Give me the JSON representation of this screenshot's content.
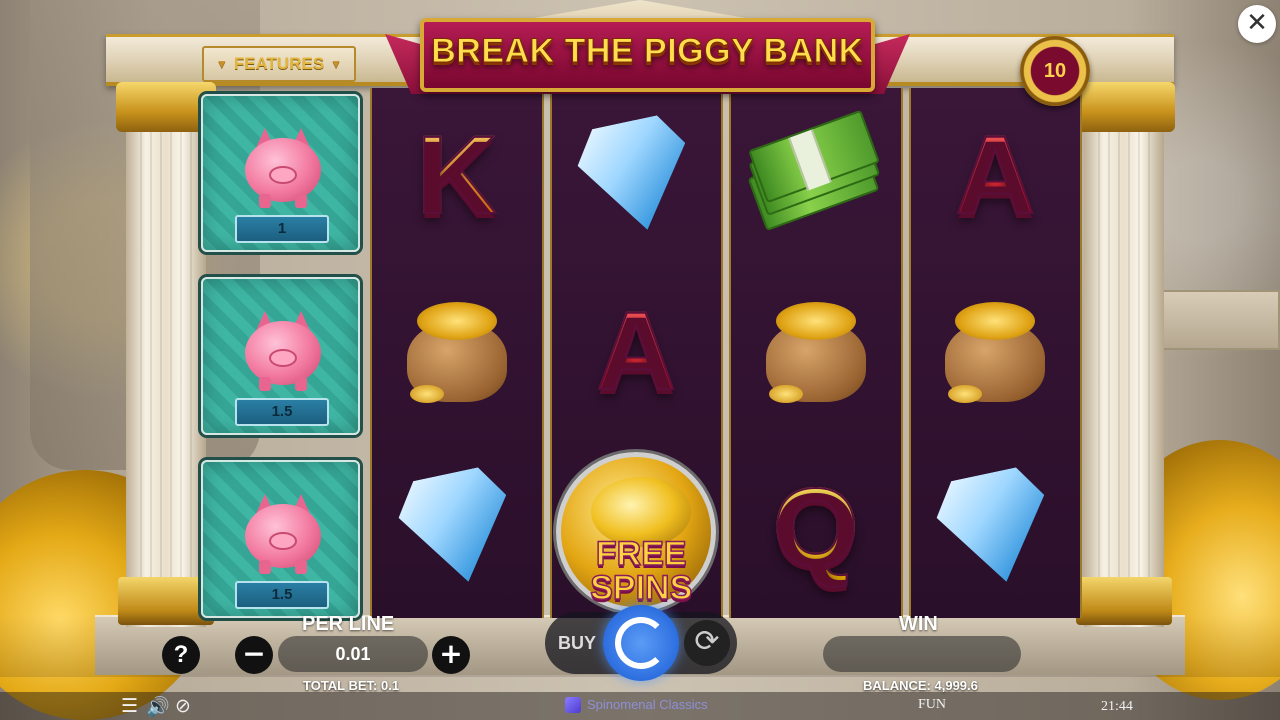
{
  "game": {
    "title": "BREAK THE PIGGY BANK",
    "features_label": "FEATURES",
    "lines_count": "10"
  },
  "feature_panel": {
    "piggies": [
      {
        "value": "1"
      },
      {
        "value": "1.5"
      },
      {
        "value": "1.5"
      }
    ]
  },
  "reels": [
    [
      "K",
      "gold-sack",
      "diamond"
    ],
    [
      "diamond",
      "A",
      "free-spins"
    ],
    [
      "money-stack",
      "gold-sack",
      "Q"
    ],
    [
      "A",
      "gold-sack",
      "diamond"
    ]
  ],
  "scatter": {
    "line1": "FREE",
    "line2": "SPINS"
  },
  "controls": {
    "help_label": "?",
    "per_line_label": "PER LINE",
    "per_line_value": "0.01",
    "minus_label": "−",
    "plus_label": "+",
    "total_bet_label": "TOTAL BET: 0.1",
    "buy_label": "BUY",
    "win_label": "WIN",
    "win_value": "",
    "balance_label": "BALANCE: 4,999.6"
  },
  "footer": {
    "brand": "Spinomenal Classics",
    "mode": "FUN",
    "time": "21:44"
  },
  "colors": {
    "reel_bg": "#2a0f2a",
    "accent_gold": "#e0a416",
    "spin_blue": "#2d6ee0",
    "banner_red": "#8a0f3a"
  }
}
